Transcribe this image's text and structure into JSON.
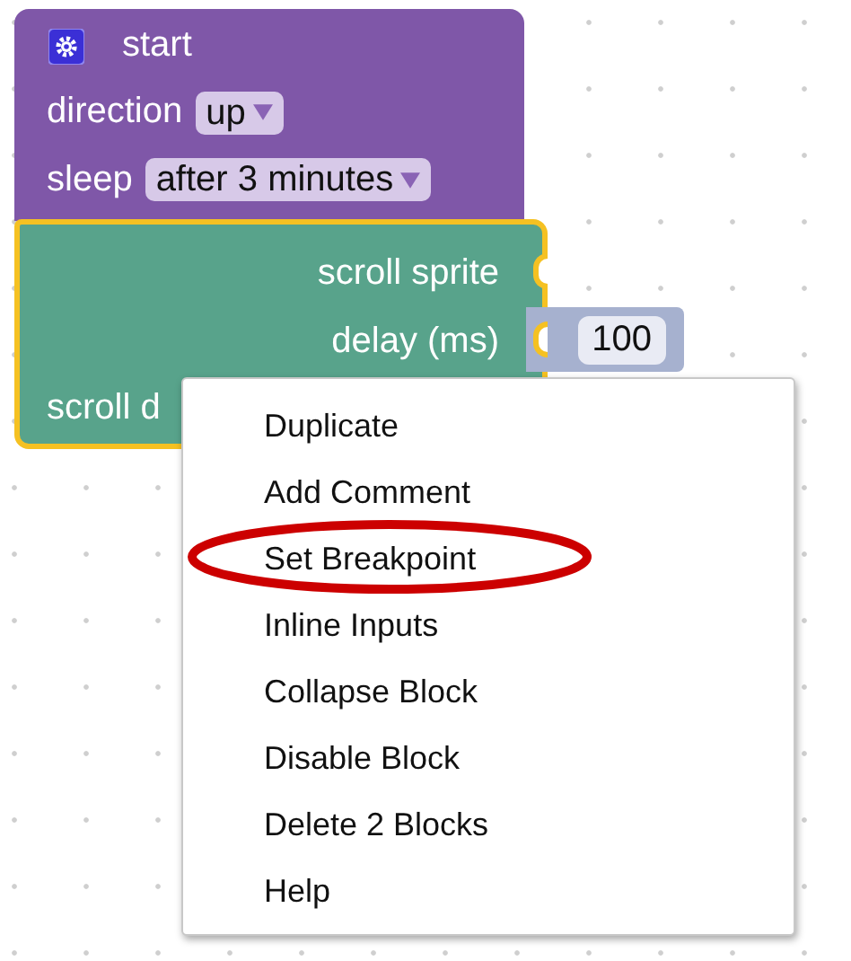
{
  "start_block": {
    "title": "start",
    "fields": [
      {
        "label": "direction",
        "value": "up"
      },
      {
        "label": "sleep",
        "value": "after 3 minutes"
      }
    ]
  },
  "scroll_block": {
    "selected": true,
    "inputs": [
      {
        "label": "scroll sprite"
      },
      {
        "label": "delay (ms)",
        "value": "100"
      }
    ],
    "footer": "scroll d"
  },
  "context_menu": {
    "items": [
      {
        "label": "Duplicate",
        "circled": false
      },
      {
        "label": "Add Comment",
        "circled": false
      },
      {
        "label": "Set Breakpoint",
        "circled": true
      },
      {
        "label": "Inline Inputs",
        "circled": false
      },
      {
        "label": "Collapse Block",
        "circled": false
      },
      {
        "label": "Disable Block",
        "circled": false
      },
      {
        "label": "Delete 2 Blocks",
        "circled": false
      },
      {
        "label": "Help",
        "circled": false
      }
    ]
  }
}
